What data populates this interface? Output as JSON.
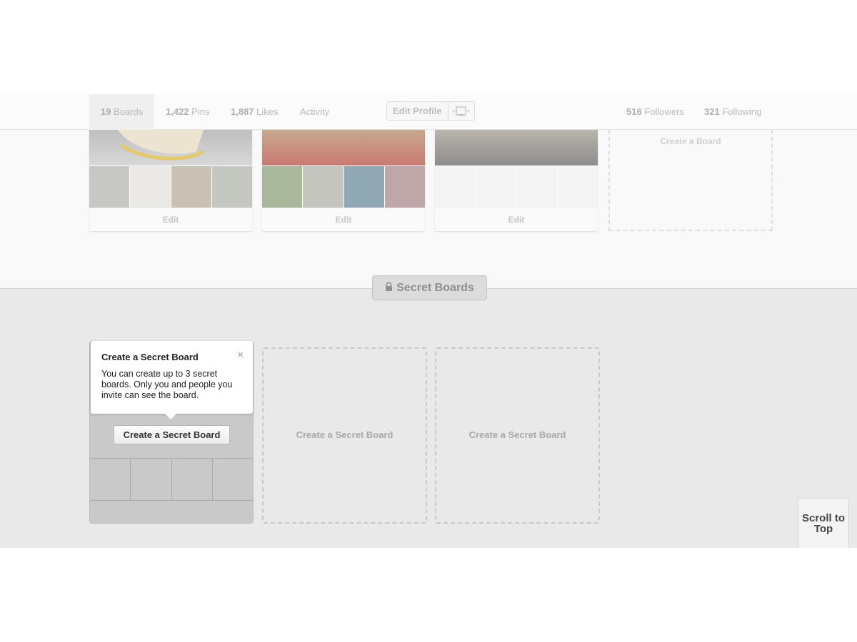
{
  "profile_nav": {
    "tabs": [
      {
        "count": "19",
        "label": "Boards"
      },
      {
        "count": "1,422",
        "label": "Pins"
      },
      {
        "count": "1,887",
        "label": "Likes"
      },
      {
        "count": "",
        "label": "Activity"
      }
    ],
    "edit_profile_label": "Edit Profile",
    "followers": {
      "count": "516",
      "label": "Followers"
    },
    "following": {
      "count": "321",
      "label": "Following"
    }
  },
  "boards": [
    {
      "edit_label": "Edit"
    },
    {
      "edit_label": "Edit"
    },
    {
      "edit_label": "Edit"
    }
  ],
  "create_board_label": "Create a Board",
  "secret_section": {
    "header": "Secret Boards",
    "tooltip": {
      "title": "Create a Secret Board",
      "body": "You can create up to 3 secret boards. Only you and people you invite can see the board.",
      "close": "×"
    },
    "create_button_label": "Create a Secret Board",
    "placeholders": [
      "Create a Secret Board",
      "Create a Secret Board"
    ]
  },
  "scroll_to_top_label": "Scroll to Top",
  "colors": {
    "secret_bg": "#e9e9e9",
    "upper_bg": "#f9f9f9"
  }
}
